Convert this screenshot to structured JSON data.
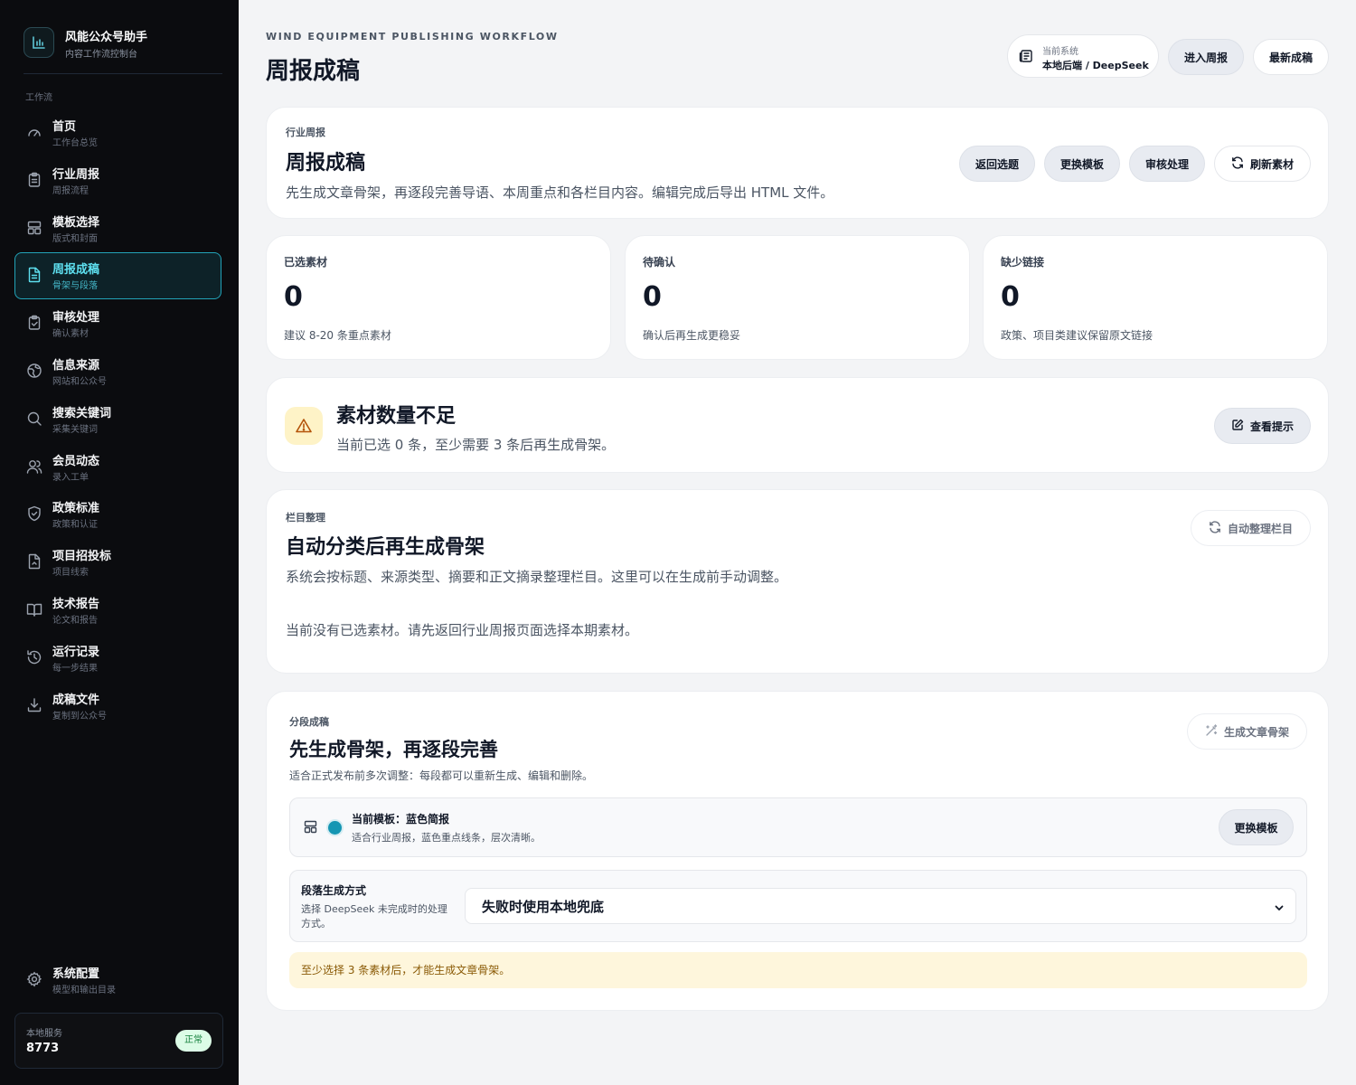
{
  "sidebar": {
    "brand_title": "风能公众号助手",
    "brand_sub": "内容工作流控制台",
    "section_label": "工作流",
    "items": [
      {
        "label": "首页",
        "sub": "工作台总览",
        "icon": "gauge-icon"
      },
      {
        "label": "行业周报",
        "sub": "周报流程",
        "icon": "clipboard-icon"
      },
      {
        "label": "模板选择",
        "sub": "版式和封面",
        "icon": "layout-icon"
      },
      {
        "label": "周报成稿",
        "sub": "骨架与段落",
        "icon": "document-icon",
        "active": true
      },
      {
        "label": "审核处理",
        "sub": "确认素材",
        "icon": "clipboard-check-icon"
      },
      {
        "label": "信息来源",
        "sub": "网站和公众号",
        "icon": "globe-icon"
      },
      {
        "label": "搜索关键词",
        "sub": "采集关键词",
        "icon": "search-icon"
      },
      {
        "label": "会员动态",
        "sub": "录入工单",
        "icon": "users-icon"
      },
      {
        "label": "政策标准",
        "sub": "政策和认证",
        "icon": "shield-icon"
      },
      {
        "label": "项目招投标",
        "sub": "项目线索",
        "icon": "file-icon"
      },
      {
        "label": "技术报告",
        "sub": "论文和报告",
        "icon": "book-icon"
      },
      {
        "label": "运行记录",
        "sub": "每一步结果",
        "icon": "history-icon"
      },
      {
        "label": "成稿文件",
        "sub": "复制到公众号",
        "icon": "download-icon"
      }
    ],
    "settings": {
      "label": "系统配置",
      "sub": "模型和输出目录",
      "icon": "gear-icon"
    },
    "service": {
      "label": "本地服务",
      "value": "8773",
      "status": "正常"
    }
  },
  "header": {
    "eyebrow": "WIND EQUIPMENT PUBLISHING WORKFLOW",
    "title": "周报成稿",
    "system_label": "当前系统",
    "system_value": "本地后端 / DeepSeek",
    "btn_enter": "进入周报",
    "btn_latest": "最新成稿"
  },
  "intro": {
    "eyebrow": "行业周报",
    "title": "周报成稿",
    "desc": "先生成文章骨架，再逐段完善导语、本周重点和各栏目内容。编辑完成后导出 HTML 文件。",
    "btn_back": "返回选题",
    "btn_template": "更换模板",
    "btn_review": "审核处理",
    "btn_refresh": "刷新素材"
  },
  "stats": [
    {
      "label": "已选素材",
      "value": "0",
      "hint": "建议 8-20 条重点素材"
    },
    {
      "label": "待确认",
      "value": "0",
      "hint": "确认后再生成更稳妥"
    },
    {
      "label": "缺少链接",
      "value": "0",
      "hint": "政策、项目类建议保留原文链接"
    }
  ],
  "warning": {
    "title": "素材数量不足",
    "desc": "当前已选 0 条，至少需要 3 条后再生成骨架。",
    "btn": "查看提示"
  },
  "columns": {
    "eyebrow": "栏目整理",
    "title": "自动分类后再生成骨架",
    "desc": "系统会按标题、来源类型、摘要和正文摘录整理栏目。这里可以在生成前手动调整。",
    "empty": "当前没有已选素材。请先返回行业周报页面选择本期素材。",
    "btn": "自动整理栏目"
  },
  "draft": {
    "eyebrow": "分段成稿",
    "title": "先生成骨架，再逐段完善",
    "desc": "适合正式发布前多次调整：每段都可以重新生成、编辑和删除。",
    "btn": "生成文章骨架",
    "template_name": "当前模板：蓝色简报",
    "template_desc": "适合行业周报，蓝色重点线条，层次清晰。",
    "template_btn": "更换模板",
    "template_dot_color": "#1596b3",
    "mode_label": "段落生成方式",
    "mode_desc_1": "选择 DeepSeek 未完成时的处理",
    "mode_desc_2": "方式。",
    "mode_value": "失败时使用本地兜底",
    "notice": "至少选择 3 条素材后，才能生成文章骨架。"
  }
}
